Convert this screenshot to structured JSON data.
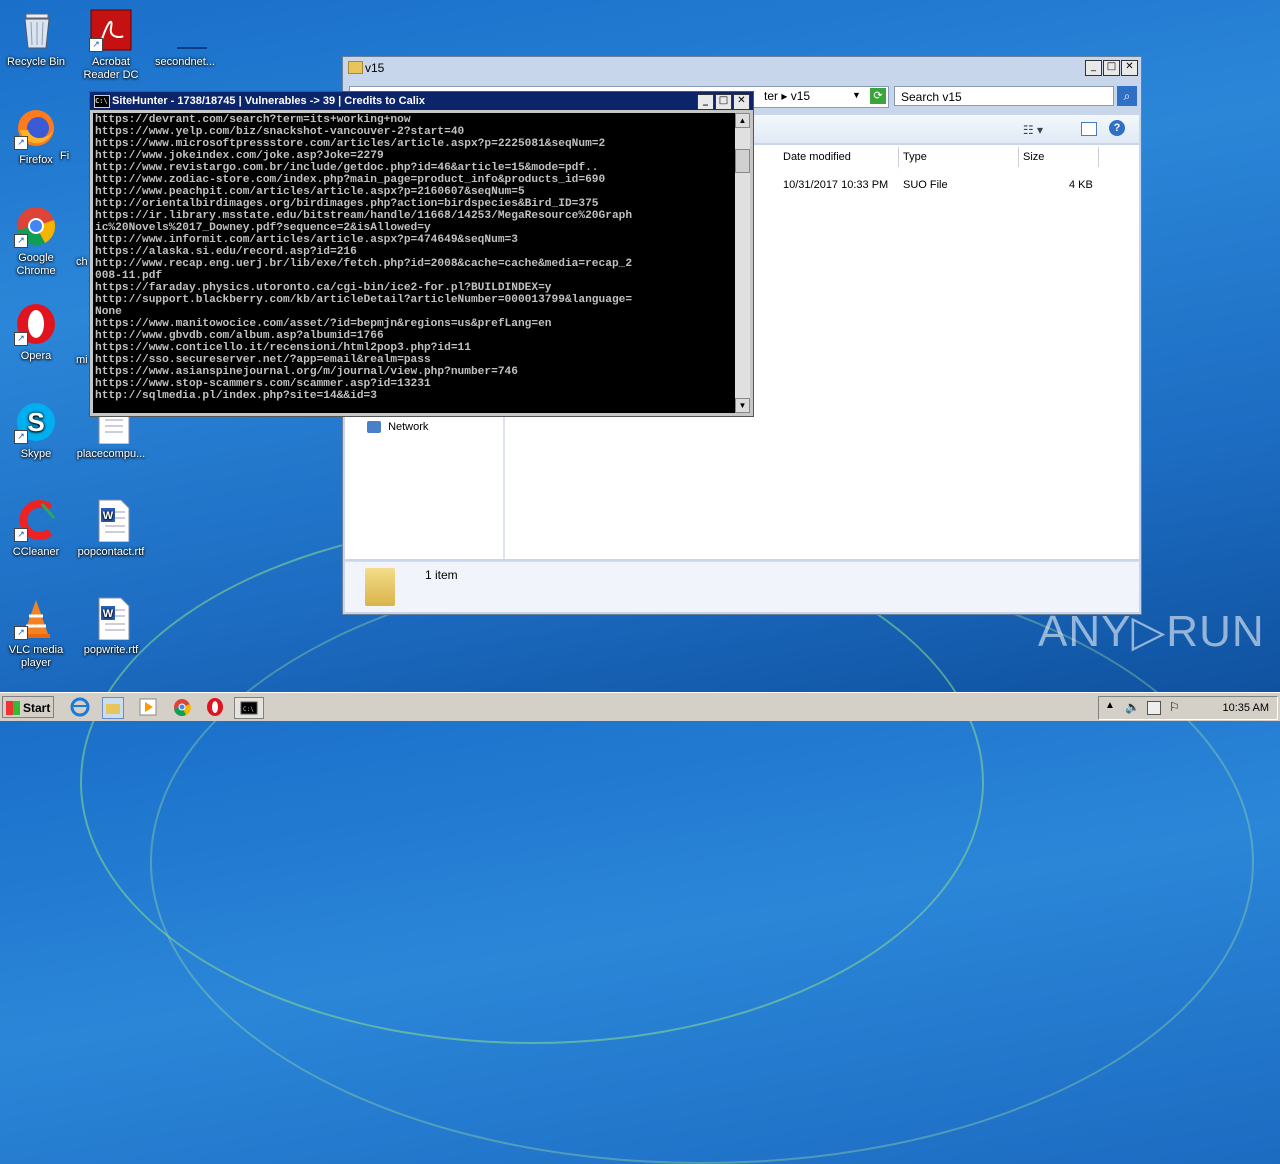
{
  "desktop": {
    "icons": [
      {
        "label": "Recycle Bin"
      },
      {
        "label": "Acrobat\nReader DC"
      },
      {
        "label": "secondnet..."
      },
      {
        "label": "Firefox"
      },
      {
        "label": "Fi"
      },
      {
        "label": "Google\nChrome"
      },
      {
        "label": "ch"
      },
      {
        "label": "Opera"
      },
      {
        "label": "mi"
      },
      {
        "label": "Skype"
      },
      {
        "label": "placecompu..."
      },
      {
        "label": "CCleaner"
      },
      {
        "label": "popcontact.rtf"
      },
      {
        "label": "VLC media\nplayer"
      },
      {
        "label": "popwrite.rtf"
      }
    ]
  },
  "explorer": {
    "title": "v15",
    "address_tail": "ter  ▸  v15",
    "search_placeholder": "Search v15",
    "columns": {
      "date_modified": "Date modified",
      "type": "Type",
      "size": "Size"
    },
    "file": {
      "date": "10/31/2017 10:33 PM",
      "type": "SUO File",
      "size": "4 KB"
    },
    "nav_network": "Network",
    "status": "1 item"
  },
  "console": {
    "title": "SiteHunter - 1738/18745 | Vulnerables -> 39 | Credits to Calix",
    "icon_text": "C:\\",
    "output": "https://devrant.com/search?term=its+working+now\nhttps://www.yelp.com/biz/snackshot-vancouver-2?start=40\nhttps://www.microsoftpressstore.com/articles/article.aspx?p=2225081&seqNum=2\nhttp://www.jokeindex.com/joke.asp?Joke=2279\nhttp://www.revistargo.com.br/include/getdoc.php?id=46&article=15&mode=pdf..\nhttp://www.zodiac-store.com/index.php?main_page=product_info&products_id=690\nhttp://www.peachpit.com/articles/article.aspx?p=2160607&seqNum=5\nhttp://orientalbirdimages.org/birdimages.php?action=birdspecies&Bird_ID=375\nhttps://ir.library.msstate.edu/bitstream/handle/11668/14253/MegaResource%20Graph\nic%20Novels%2017_Downey.pdf?sequence=2&isAllowed=y\nhttp://www.informit.com/articles/article.aspx?p=474649&seqNum=3\nhttps://alaska.si.edu/record.asp?id=216\nhttp://www.recap.eng.uerj.br/lib/exe/fetch.php?id=2008&cache=cache&media=recap_2\n008-11.pdf\nhttps://faraday.physics.utoronto.ca/cgi-bin/ice2-for.pl?BUILDINDEX=y\nhttp://support.blackberry.com/kb/articleDetail?articleNumber=000013799&language=\nNone\nhttps://www.manitowocice.com/asset/?id=bepmjn&regions=us&prefLang=en\nhttp://www.gbvdb.com/album.asp?albumid=1766\nhttps://www.conticello.it/recensioni/html2pop3.php?id=11\nhttps://sso.secureserver.net/?app=email&realm=pass\nhttps://www.asianspinejournal.org/m/journal/view.php?number=746\nhttps://www.stop-scammers.com/scammer.asp?id=13231\nhttp://sqlmedia.pl/index.php?site=14&&id=3"
  },
  "taskbar": {
    "start_label": "Start",
    "clock": "10:35 AM",
    "icons": [
      "ie-icon",
      "explorer-icon",
      "media-player-icon",
      "chrome-icon",
      "opera-icon",
      "cmd-icon"
    ]
  },
  "watermark": "ANY▷RUN"
}
